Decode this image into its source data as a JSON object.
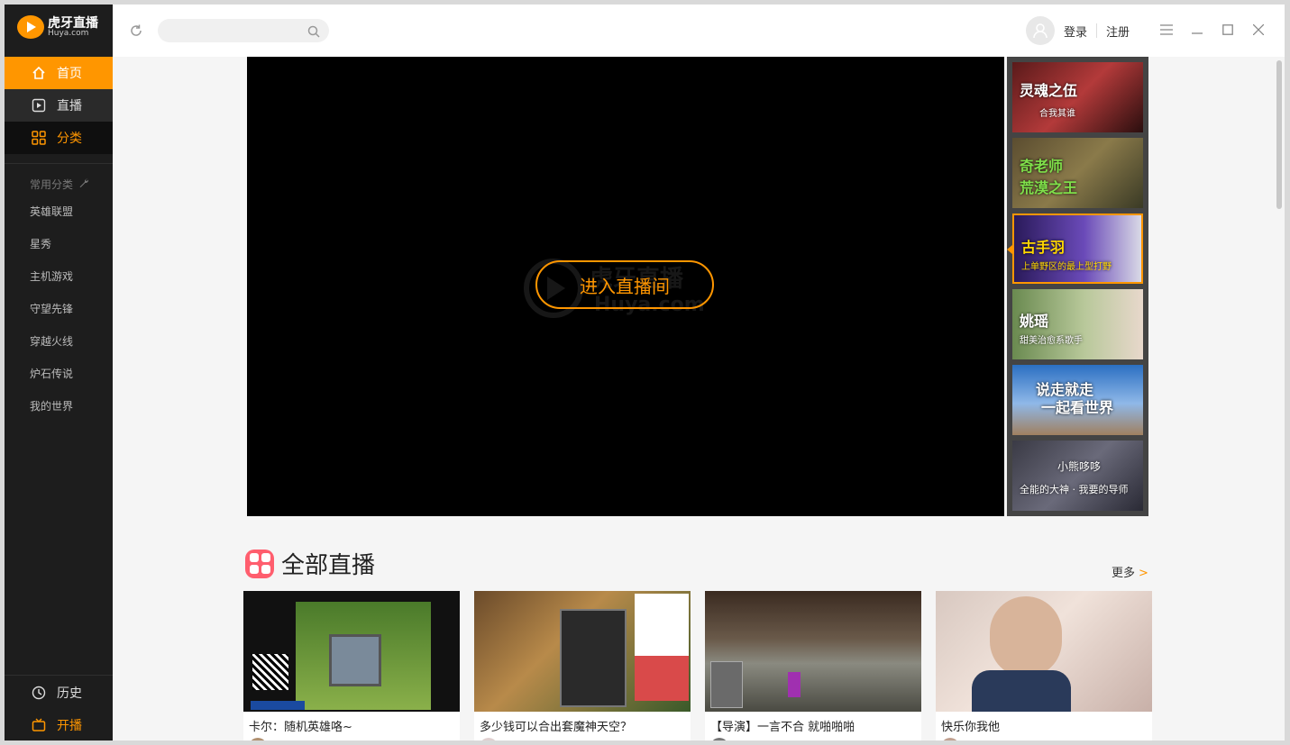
{
  "app": {
    "logo_title": "虎牙直播",
    "logo_sub": "Huya.com"
  },
  "nav": [
    {
      "label": "首页",
      "icon": "home-icon"
    },
    {
      "label": "直播",
      "icon": "play-icon"
    },
    {
      "label": "分类",
      "icon": "grid-icon"
    }
  ],
  "categories": {
    "heading": "常用分类",
    "items": [
      "英雄联盟",
      "星秀",
      "主机游戏",
      "守望先锋",
      "穿越火线",
      "炉石传说",
      "我的世界"
    ]
  },
  "bottom_nav": {
    "history": "历史",
    "broadcast": "开播"
  },
  "header": {
    "search_placeholder": "",
    "login": "登录",
    "register": "注册"
  },
  "player": {
    "enter_button": "进入直播间",
    "watermark_cn": "虎牙直播",
    "watermark_en": "Huya.com"
  },
  "featured_thumbs": [
    {
      "title": "灵魂之伍",
      "subtitle": "合我其谁"
    },
    {
      "title": "奇老师",
      "subtitle": "荒漠之王"
    },
    {
      "title": "古手羽",
      "subtitle": "上单野区的最上型打野"
    },
    {
      "title": "姚瑶",
      "subtitle": "甜美治愈系歌手"
    },
    {
      "title": "说走就走",
      "subtitle": "一起看世界"
    },
    {
      "title": "小熊哆哆",
      "subtitle": "全能的大神 · 我要的导师"
    }
  ],
  "section": {
    "title": "全部直播",
    "more": "更多",
    "more_arrow": ">"
  },
  "live_cards": [
    {
      "title": "卡尔：随机英雄咯~"
    },
    {
      "title": "多少钱可以合出套魔神天空？"
    },
    {
      "title": "【导演】一言不合 就啪啪啪"
    },
    {
      "title": "快乐你我他"
    }
  ],
  "colors": {
    "accent": "#ff9600",
    "sidebar_bg": "#1d1d1d",
    "section_icon": "#ff5e6e"
  }
}
